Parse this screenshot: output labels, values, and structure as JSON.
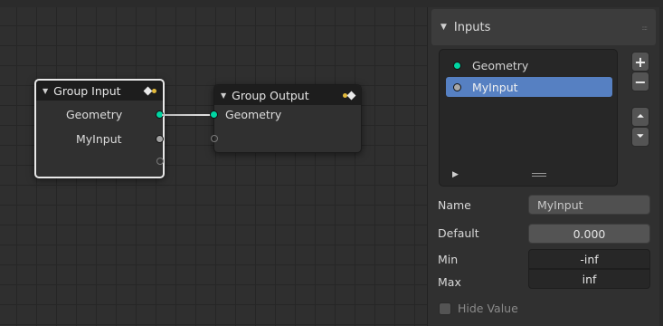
{
  "canvas": {
    "group_input_node": {
      "title": "Group Input",
      "outputs": [
        {
          "label": "Geometry",
          "socket": "geometry-socket"
        },
        {
          "label": "MyInput",
          "socket": "value-socket"
        }
      ]
    },
    "group_output_node": {
      "title": "Group Output",
      "inputs": [
        {
          "label": "Geometry",
          "socket": "geometry-socket"
        }
      ]
    },
    "icons": {
      "collapse": "chevron-down-icon",
      "group": "group-node-icon"
    }
  },
  "sidebar": {
    "panel_title": "Inputs",
    "list": [
      {
        "label": "Geometry",
        "socket": "geometry-socket",
        "active": false
      },
      {
        "label": "MyInput",
        "socket": "value-socket",
        "active": true
      }
    ],
    "add_button": "+",
    "remove_button": "−",
    "move_up_button": "⏶",
    "move_down_button": "⏷",
    "properties": {
      "name_label": "Name",
      "name_value": "MyInput",
      "default_label": "Default",
      "default_value": "0.000",
      "min_label": "Min",
      "min_value": "-inf",
      "max_label": "Max",
      "max_value": "inf",
      "hide_value_label": "Hide Value"
    }
  },
  "colors": {
    "geometry_socket": "#00d6a3",
    "value_socket": "#a1a1a1",
    "accent": "#5680c2",
    "group_icon_dot": "#e2b93b"
  }
}
